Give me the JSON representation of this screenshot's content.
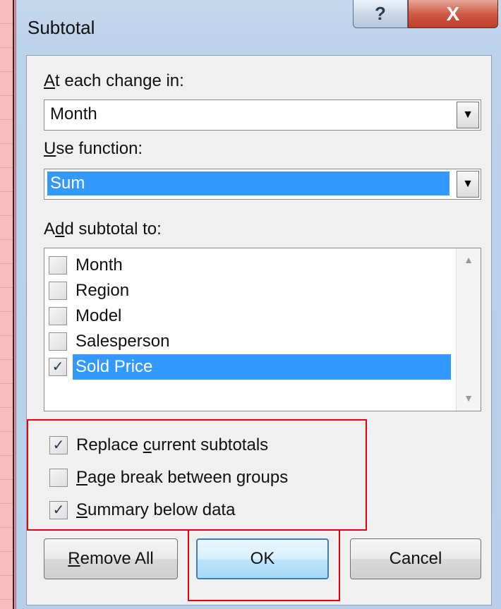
{
  "dialog": {
    "title": "Subtotal",
    "help_glyph": "?",
    "close_glyph": "X"
  },
  "at_each_change": {
    "label_prefix": "",
    "label_mnemonic": "A",
    "label_rest": "t each change in:",
    "value": "Month"
  },
  "use_function": {
    "label_mnemonic": "U",
    "label_rest": "se function:",
    "value": "Sum"
  },
  "add_subtotal": {
    "label_prefix": "A",
    "label_mnemonic": "d",
    "label_rest": "d subtotal to:",
    "items": [
      {
        "label": "Month",
        "checked": false,
        "selected": false
      },
      {
        "label": "Region",
        "checked": false,
        "selected": false
      },
      {
        "label": "Model",
        "checked": false,
        "selected": false
      },
      {
        "label": "Salesperson",
        "checked": false,
        "selected": false
      },
      {
        "label": "Sold Price",
        "checked": true,
        "selected": true
      }
    ]
  },
  "options": {
    "replace": {
      "prefix": "Replace ",
      "mnemonic": "c",
      "rest": "urrent subtotals",
      "checked": true
    },
    "page_break": {
      "prefix": "",
      "mnemonic": "P",
      "rest": "age break between groups",
      "checked": false
    },
    "summary": {
      "prefix": "",
      "mnemonic": "S",
      "rest": "ummary below data",
      "checked": true
    }
  },
  "buttons": {
    "remove_all": {
      "mnemonic": "R",
      "rest": "emove All"
    },
    "ok": "OK",
    "cancel": "Cancel"
  },
  "glyphs": {
    "check": "✓",
    "dropdown": "▼",
    "scroll_up": "▲",
    "scroll_down": "▼"
  },
  "colors": {
    "selection": "#3399ff",
    "highlight_border": "#e8000b",
    "close_button": "#c03d28"
  }
}
